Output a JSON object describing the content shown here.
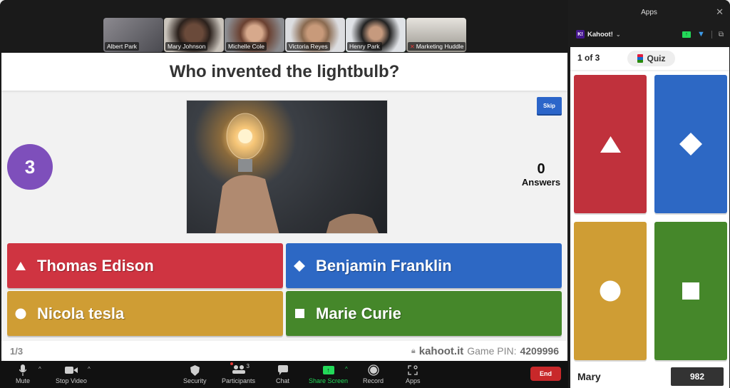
{
  "participants": [
    {
      "name": "Albert Park",
      "bg": "#6b6a6e",
      "active": false,
      "muted": false
    },
    {
      "name": "Mary Johnson",
      "bg": "#7a6a5c",
      "active": false,
      "muted": false
    },
    {
      "name": "Michelle Cole",
      "bg": "#8b7060",
      "active": false,
      "muted": false
    },
    {
      "name": "Victoria Reyes",
      "bg": "#a9a7a6",
      "active": false,
      "muted": false
    },
    {
      "name": "Henry Park",
      "bg": "#c3c5c8",
      "active": true,
      "muted": false
    },
    {
      "name": "Marketing Huddle",
      "bg": "#b8b4ae",
      "active": false,
      "muted": true
    }
  ],
  "game": {
    "question": "Who invented the lightbulb?",
    "timer": "3",
    "skip_label": "Skip",
    "answers_count": "0",
    "answers_label": "Answers",
    "image_alt": "Hand holding a glowing lightbulb",
    "options": [
      {
        "shape": "triangle",
        "label": "Thomas Edison",
        "color": "#cf3441"
      },
      {
        "shape": "diamond",
        "label": "Benjamin Franklin",
        "color": "#2d68c4"
      },
      {
        "shape": "circle",
        "label": "Nicola tesla",
        "color": "#cf9d34"
      },
      {
        "shape": "square",
        "label": "Marie Curie",
        "color": "#45872a"
      }
    ],
    "question_counter": "1/3",
    "url": "kahoot.it",
    "pin_label": "Game PIN:",
    "pin": "4209996"
  },
  "toolbar": {
    "mute": "Mute",
    "stop_video": "Stop Video",
    "security": "Security",
    "participants": "Participants",
    "participants_count": "3",
    "chat": "Chat",
    "share_screen": "Share Screen",
    "record": "Record",
    "apps": "Apps",
    "end": "End"
  },
  "apps_panel": {
    "title": "Apps",
    "app_name": "Kahoot!",
    "progress": "1 of 3",
    "quiz_label": "Quiz",
    "player_name": "Mary",
    "player_score": "982"
  }
}
